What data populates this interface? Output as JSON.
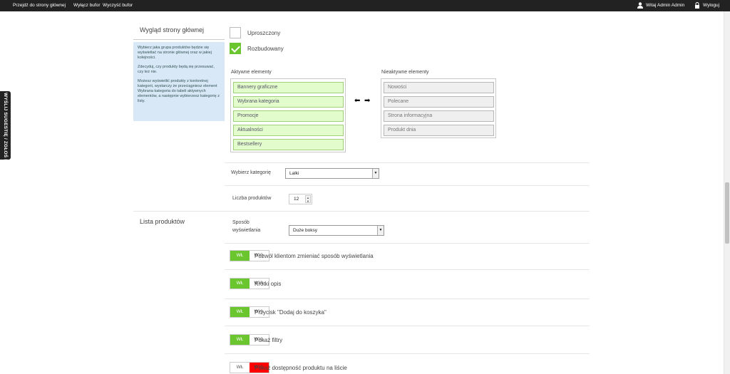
{
  "topbar": {
    "links": [
      "Przejdź do strony głównej",
      "Wyłącz bufor",
      "Wyczyść bufor"
    ],
    "user": "Witaj Admin Admin",
    "logout": "Wyloguj"
  },
  "side_tab": "WYŚLIJ SUGESTIĘ / ZGŁOŚ BŁĄD",
  "homepage": {
    "section_title": "Wygląd strony głównej",
    "info": [
      "Wybierz jaka grupa produktów będzie się wyświetlać na stronie głównej oraz w jakiej kolejności.",
      "Zdecyduj, czy produkty będą się przesuwać, czy też nie.",
      "Możesz wyświetlić produkty z konkretnej kategorii, wystarczy że przeciągniesz element Wybrana kategoria do tabeli aktywnych elementów, a następnie wybierzesz kategorię z listy."
    ],
    "layout_options": [
      {
        "label": "Uproszczony",
        "checked": false
      },
      {
        "label": "Rozbudowany",
        "checked": true
      }
    ],
    "active_title": "Aktywne elementy",
    "active_items": [
      "Bannery graficzne",
      "Wybrana kategoria",
      "Promocje",
      "Aktualności",
      "Bestsellery"
    ],
    "inactive_title": "Nieaktywne elementy",
    "inactive_items": [
      "Nowości",
      "Polecane",
      "Strona informacyjna",
      "Produkt dnia"
    ],
    "category_label": "Wybierz kategorię",
    "category_value": "Lalki",
    "count_label": "Liczba produktów",
    "count_value": "12"
  },
  "product_list": {
    "section_title": "Lista produktów",
    "display_label_1": "Sposób",
    "display_label_2": "wyświetlania",
    "display_value": "Duże boksy",
    "toggle_on": "WŁ",
    "toggle_off": "WYŁ",
    "toggles": [
      {
        "label": "Pozwól klientom zmieniać sposób wyświetlania",
        "state": "on"
      },
      {
        "label": "Krótki opis",
        "state": "on"
      },
      {
        "label": "Przycisk \"Dodaj do koszyka\"",
        "state": "on"
      },
      {
        "label": "Pokaż filtry",
        "state": "on"
      },
      {
        "label": "Pokaż dostępność produktu na liście",
        "state": "off"
      }
    ]
  },
  "colors": {
    "accent_green": "#6ac52e",
    "off_red": "#ff0000",
    "info_bg": "#d9e8f7"
  }
}
